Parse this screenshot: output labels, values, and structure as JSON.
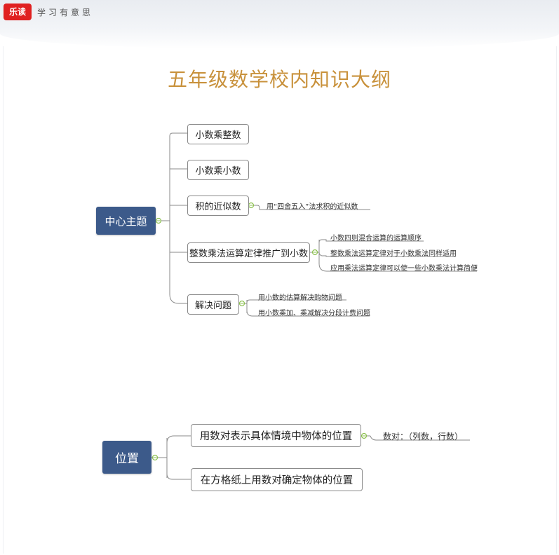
{
  "header": {
    "logo": "乐读",
    "slogan": "学习有意思"
  },
  "title": "五年级数学校内知识大纲",
  "map1": {
    "root": "中心主题",
    "branches": [
      {
        "label": "小数乘整数"
      },
      {
        "label": "小数乘小数"
      },
      {
        "label": "积的近似数",
        "leaves": [
          "用“四舍五入”法求积的近似数"
        ]
      },
      {
        "label": "整数乘法运算定律推广到小数",
        "leaves": [
          "小数四则混合运算的运算顺序",
          "整数乘法运算定律对于小数乘法同样适用",
          "应用乘法运算定律可以使一些小数乘法计算简便"
        ]
      },
      {
        "label": "解决问题",
        "leaves": [
          "用小数的估算解决购物问题",
          "用小数乘加、乘减解决分段计费问题"
        ]
      }
    ]
  },
  "map2": {
    "root": "位置",
    "branches": [
      {
        "label": "用数对表示具体情境中物体的位置",
        "leaves": [
          "数对：（列数，行数）"
        ]
      },
      {
        "label": "在方格纸上用数对确定物体的位置"
      }
    ]
  },
  "colors": {
    "root": "#3c5a8a",
    "title": "#c8913b",
    "knob": "#8cc050",
    "line": "#8a8a8a"
  }
}
